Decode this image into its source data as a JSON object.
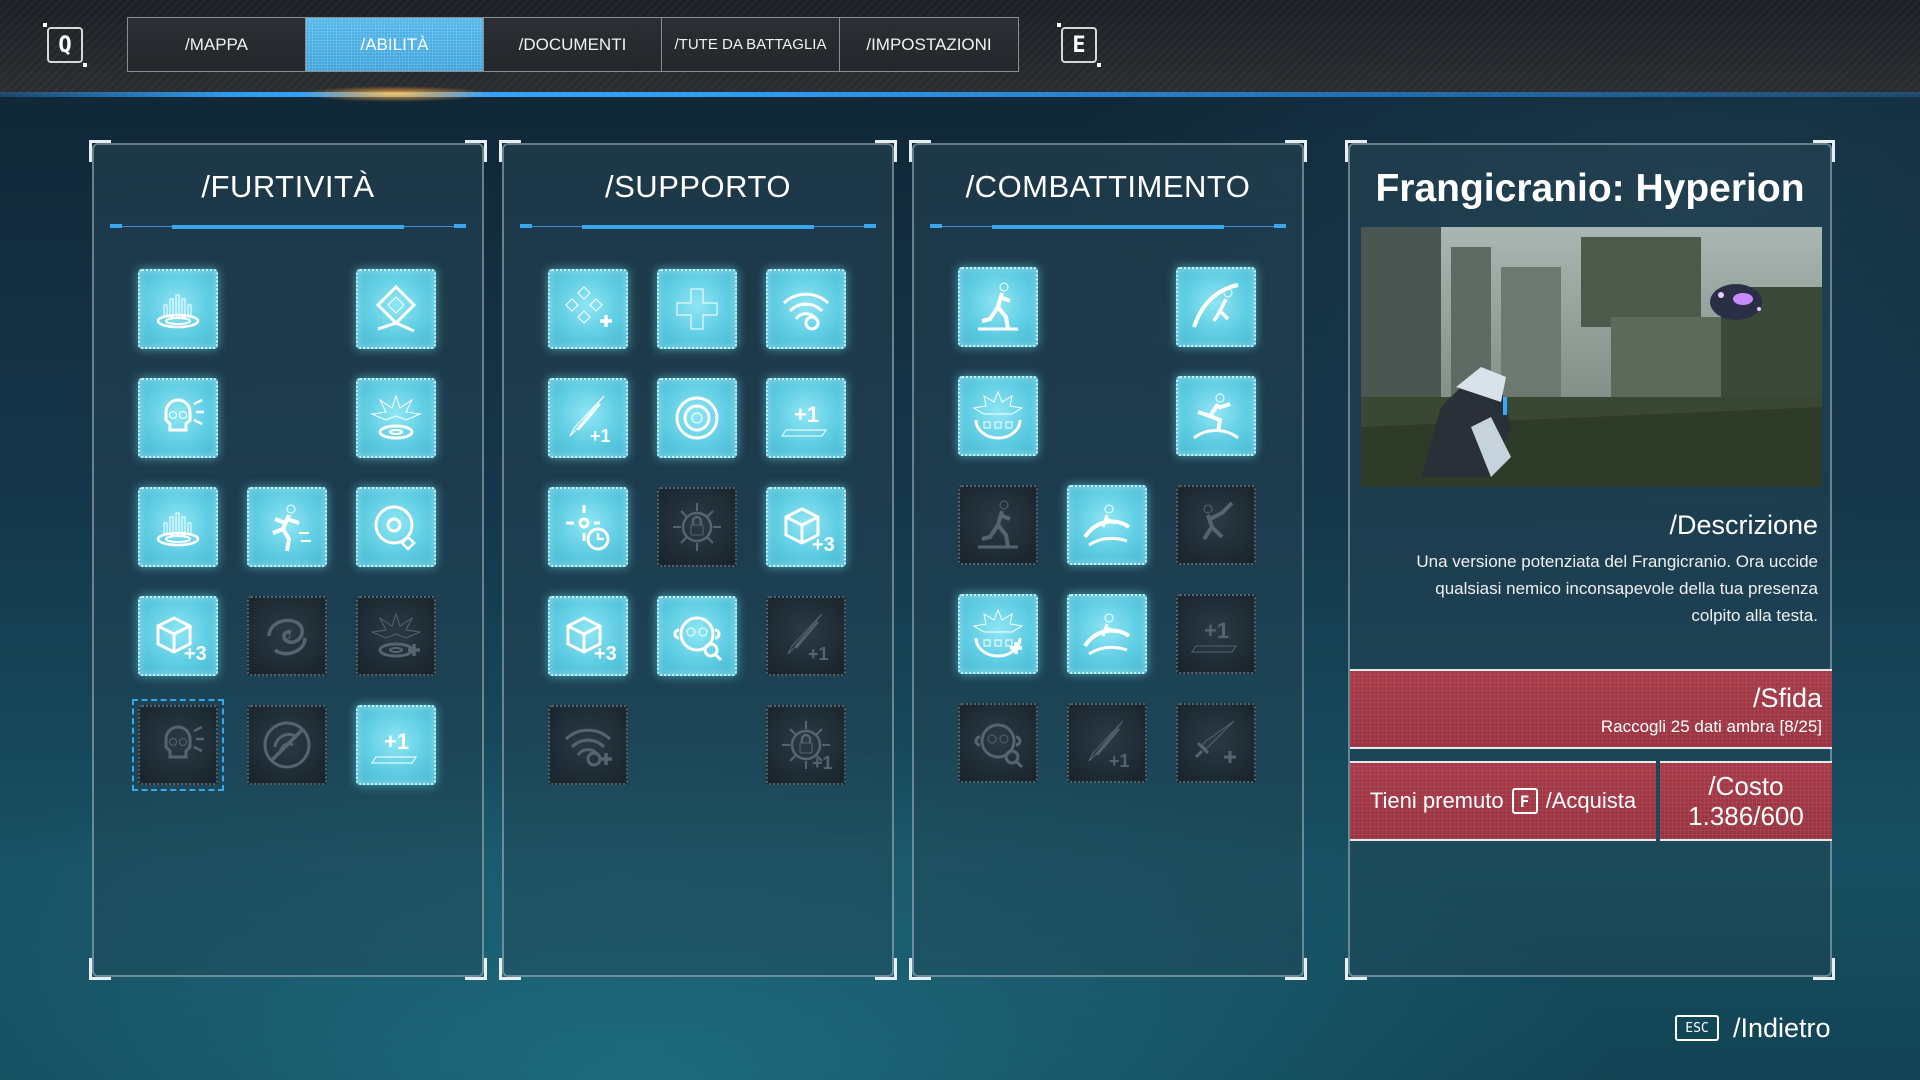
{
  "keys": {
    "left": "Q",
    "right": "E"
  },
  "tabs": [
    {
      "label": "/MAPPA",
      "active": false
    },
    {
      "label": "/ABILITÀ",
      "active": true
    },
    {
      "label": "/DOCUMENTI",
      "active": false
    },
    {
      "label": "/TUTE DA BATTAGLIA",
      "active": false
    },
    {
      "label": "/IMPOSTAZIONI",
      "active": false
    }
  ],
  "colors": {
    "active_tab": "#4aaee4",
    "accent_blue": "#3aa6ee",
    "node_unlocked": "#5fcde3",
    "node_locked": "#1e2a33",
    "challenge_red": "#a73a48",
    "glow_orange": "#ffb84a"
  },
  "categories": [
    {
      "title": "/FURTIVITÀ",
      "nodes": [
        {
          "icon": "fountain-icon",
          "state": "unlocked"
        },
        {
          "icon": "diamond-path-icon",
          "state": "unlocked"
        },
        {
          "icon": "skull-burst-icon",
          "state": "unlocked"
        },
        {
          "icon": "explosion-disc-icon",
          "state": "unlocked"
        },
        {
          "icon": "fountain-arrow-icon",
          "state": "unlocked"
        },
        {
          "icon": "takedown-runner-icon",
          "state": "unlocked"
        },
        {
          "icon": "disc-gear-icon",
          "state": "unlocked"
        },
        {
          "icon": "cube-plus-three-icon",
          "state": "unlocked",
          "badge": "+3"
        },
        {
          "icon": "swirl-icon",
          "state": "locked"
        },
        {
          "icon": "explosion-disc-plus-icon",
          "state": "locked"
        },
        {
          "icon": "skull-burst-icon",
          "state": "locked",
          "selected": true
        },
        {
          "icon": "no-signal-icon",
          "state": "locked"
        },
        {
          "icon": "plus-one-bar-icon",
          "state": "unlocked",
          "badge": "+1"
        }
      ]
    },
    {
      "title": "/SUPPORTO",
      "nodes": [
        {
          "icon": "diamond-cluster-plus-icon",
          "state": "unlocked"
        },
        {
          "icon": "plus-cross-icon",
          "state": "unlocked"
        },
        {
          "icon": "wifi-orb-icon",
          "state": "unlocked"
        },
        {
          "icon": "blade-plus-one-icon",
          "state": "unlocked",
          "badge": "+1"
        },
        {
          "icon": "target-rings-icon",
          "state": "unlocked"
        },
        {
          "icon": "plus-one-bar-icon",
          "state": "unlocked",
          "badge": "+1"
        },
        {
          "icon": "crosshair-clock-icon",
          "state": "unlocked"
        },
        {
          "icon": "lock-circuit-icon",
          "state": "locked"
        },
        {
          "icon": "cube-plus-three-icon",
          "state": "unlocked",
          "badge": "+3"
        },
        {
          "icon": "cube-plus-three-icon",
          "state": "unlocked",
          "badge": "+3"
        },
        {
          "icon": "monkey-search-icon",
          "state": "unlocked"
        },
        {
          "icon": "blade-plus-one-icon",
          "state": "locked",
          "badge": "+1"
        },
        {
          "icon": "wifi-plus-icon",
          "state": "locked"
        },
        {
          "icon": "lock-circuit-plus-icon",
          "state": "locked",
          "badge": "+1"
        }
      ]
    },
    {
      "title": "/COMBATTIMENTO",
      "nodes": [
        {
          "icon": "dash-kick-icon",
          "state": "unlocked"
        },
        {
          "icon": "slash-runner-icon",
          "state": "unlocked"
        },
        {
          "icon": "burst-orbs-icon",
          "state": "unlocked"
        },
        {
          "icon": "leap-strike-icon",
          "state": "unlocked"
        },
        {
          "icon": "dash-runner-icon",
          "state": "locked"
        },
        {
          "icon": "wave-slash-icon",
          "state": "unlocked"
        },
        {
          "icon": "grapple-icon",
          "state": "locked"
        },
        {
          "icon": "burst-orbs-plus-icon",
          "state": "unlocked"
        },
        {
          "icon": "wave-crest-icon",
          "state": "unlocked"
        },
        {
          "icon": "plus-one-bar-icon",
          "state": "locked",
          "badge": "+1"
        },
        {
          "icon": "monkey-gear-icon",
          "state": "locked"
        },
        {
          "icon": "blade-plus-one-icon",
          "state": "locked",
          "badge": "+1"
        },
        {
          "icon": "sword-plus-icon",
          "state": "locked"
        }
      ]
    }
  ],
  "detail": {
    "title": "Frangicranio: Hyperion",
    "preview_image": "combat-preview-illustration",
    "description_heading": "/Descrizione",
    "description": "Una versione potenziata del Frangicranio. Ora uccide qualsiasi nemico inconsapevole della tua presenza colpito alla testa.",
    "challenge_heading": "/Sfida",
    "challenge_text": "Raccogli 25 dati ambra [8/25]",
    "challenge_progress": 0.32,
    "purchase_prefix": "Tieni premuto",
    "purchase_key": "F",
    "purchase_action": "/Acquista",
    "cost_heading": "/Costo",
    "cost_value": "1.386/600"
  },
  "back": {
    "key": "ESC",
    "label": "/Indietro"
  }
}
